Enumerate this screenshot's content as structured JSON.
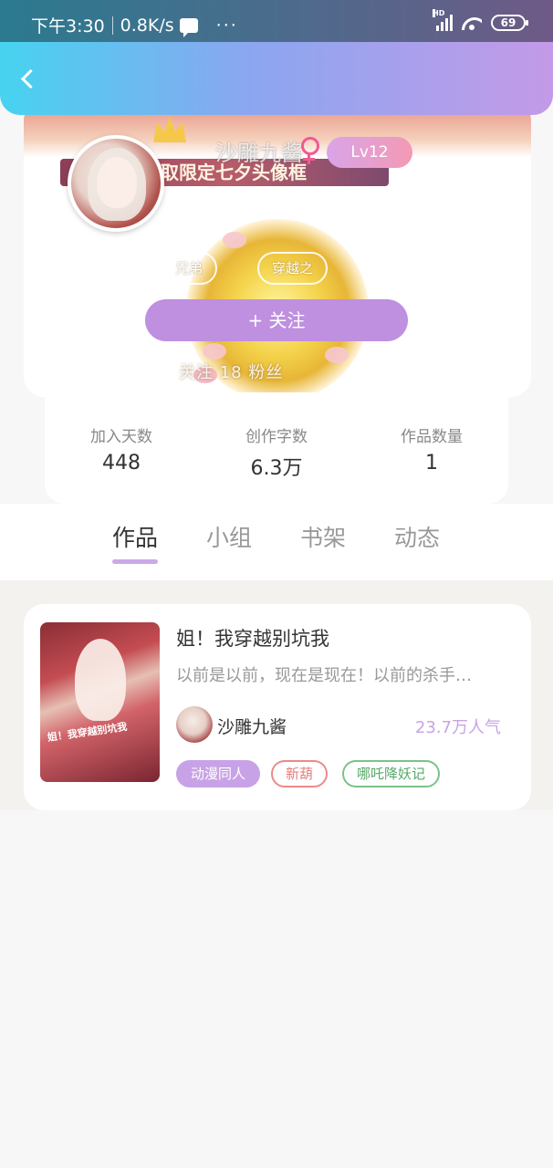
{
  "status_bar": {
    "time": "下午3:30",
    "net_speed": "0.8K/s",
    "more": "···",
    "signal_label": "HD",
    "battery": "69"
  },
  "profile": {
    "banner_ribbon": "领取限定七夕头像框",
    "username": "沙雕九酱",
    "level": "Lv12",
    "tags": [
      "兄弟",
      "穿越之"
    ],
    "follow_button": "+  关注",
    "follow_stats": "关注  18  粉丝"
  },
  "stats": [
    {
      "label": "加入天数",
      "value": "448"
    },
    {
      "label": "创作字数",
      "value": "6.3万"
    },
    {
      "label": "作品数量",
      "value": "1"
    }
  ],
  "tabs": [
    {
      "label": "作品",
      "active": true
    },
    {
      "label": "小组",
      "active": false
    },
    {
      "label": "书架",
      "active": false
    },
    {
      "label": "动态",
      "active": false
    }
  ],
  "work": {
    "cover_text": "姐！我穿越别坑我",
    "title": "姐！我穿越别坑我",
    "description": "以前是以前，现在是现在！以前的杀手…",
    "author": "沙雕九酱",
    "popularity": "23.7万人气",
    "tags": [
      "动漫同人",
      "新葫",
      "哪吒降妖记"
    ]
  },
  "colors": {
    "accent_purple": "#bf8fe0",
    "header_gradient_start": "#46d3f0",
    "header_gradient_end": "#c39ae8",
    "popularity": "#c7a4e6"
  }
}
